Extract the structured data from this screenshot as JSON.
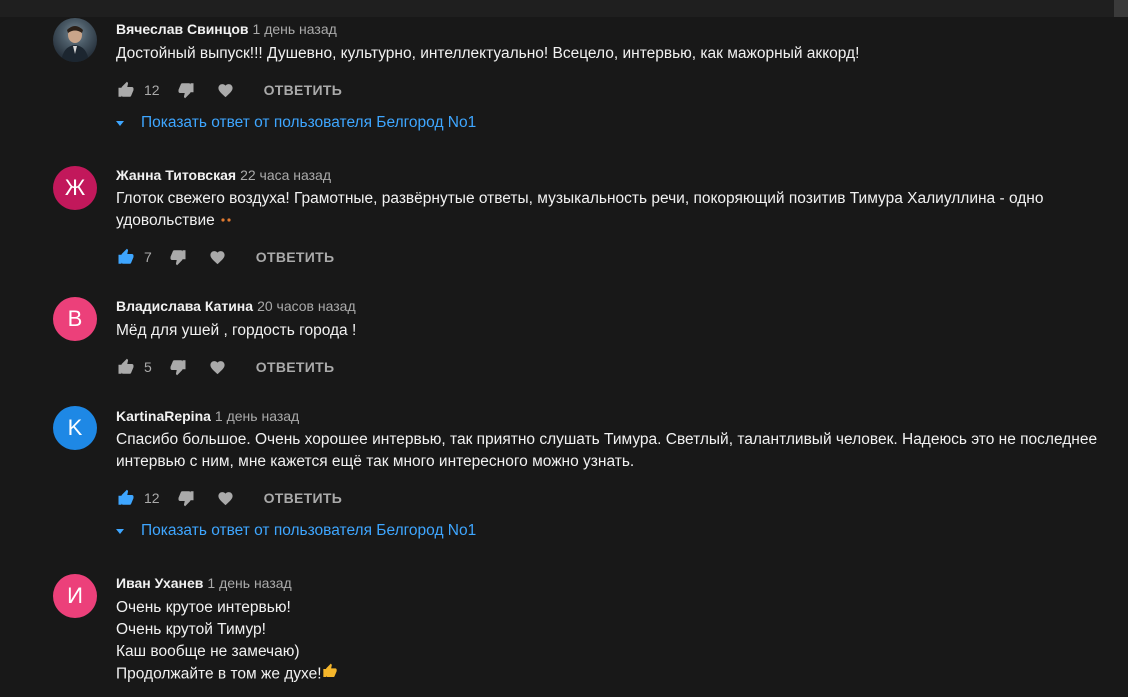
{
  "reply_label": "ОТВЕТИТЬ",
  "comments": [
    {
      "author": "Вячеслав Свинцов",
      "time": "1 день назад",
      "avatar_letter": "",
      "avatar_color": "",
      "lines": [
        "Достойный выпуск!!! Душевно, культурно, интеллектуально! Всецело, интервью, как мажорный аккорд!"
      ],
      "likes": "12",
      "liked": false,
      "replies_text": "Показать ответ от пользователя Белгород No1"
    },
    {
      "author": "Жанна Титовская",
      "time": "22 часа назад",
      "avatar_letter": "Ж",
      "avatar_color": "#c2185b",
      "lines": [
        "Глоток свежего воздуха! Грамотные, развёрнутые ответы, музыкальность речи, покоряющий позитив Тимура Халиуллина - одно",
        "удовольствие"
      ],
      "likes": "7",
      "liked": true
    },
    {
      "author": "Владислава Катина",
      "time": "20 часов назад",
      "avatar_letter": "В",
      "avatar_color": "#ec407a",
      "lines": [
        "Мёд для ушей , гордость города !"
      ],
      "likes": "5",
      "liked": false
    },
    {
      "author": "KartinaRepina",
      "time": "1 день назад",
      "avatar_letter": "K",
      "avatar_color": "#1e88e5",
      "lines": [
        "Спасибо большое. Очень хорошее интервью, так приятно слушать Тимура. Светлый, талантливый человек. Надеюсь это не последнее",
        "интервью с ним, мне кажется ещё так много интересного можно узнать."
      ],
      "likes": "12",
      "liked": true,
      "replies_text": "Показать ответ от пользователя Белгород No1"
    },
    {
      "author": "Иван Уханев",
      "time": "1 день назад",
      "avatar_letter": "И",
      "avatar_color": "#ec407a",
      "lines": [
        "Очень крутое интервью!",
        "Очень крутой Тимур!",
        "Каш вообще не замечаю)",
        "Продолжайте в том же духе!"
      ]
    }
  ],
  "colors": {
    "background": "#181818",
    "link": "#3ea6ff",
    "secondary_text": "#aaaaaa",
    "liked_icon": "#3ea6ff"
  },
  "icons": [
    "thumbs-up-icon",
    "thumbs-down-icon",
    "heart-icon",
    "caret-down-icon",
    "emoji-eyes-icon",
    "emoji-thumbs-up-icon"
  ]
}
